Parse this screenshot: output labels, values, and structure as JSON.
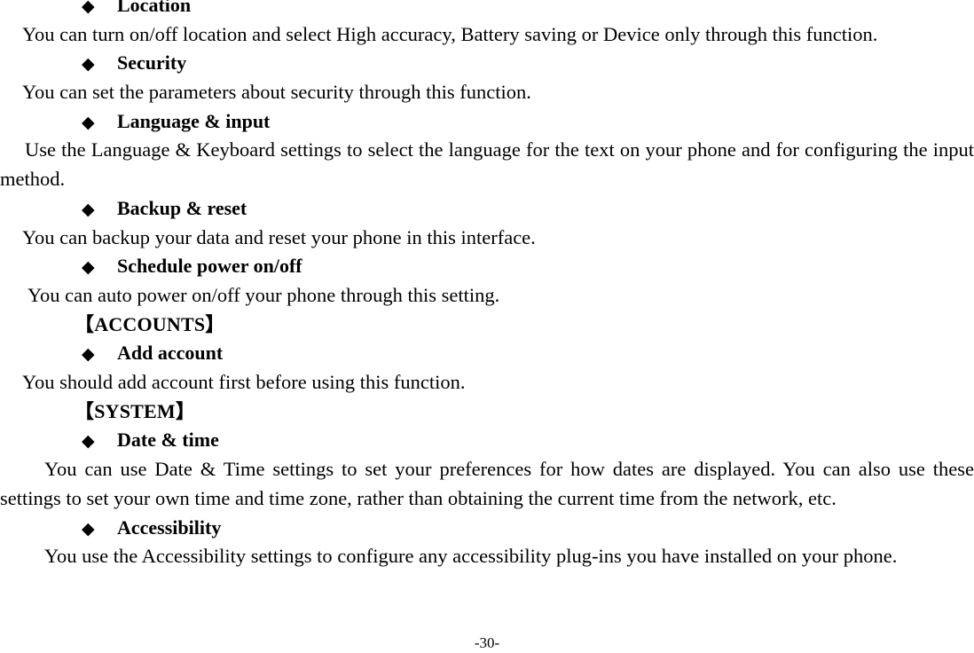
{
  "document": {
    "page_number_label": "-30-",
    "bullet_glyph": "◆",
    "bracket_open": "【",
    "bracket_close": "】",
    "text_color": "#000000",
    "background_color": "#FFFFFF"
  },
  "blocks": [
    {
      "type": "bullet_heading",
      "label": "Location"
    },
    {
      "type": "paragraph",
      "text": "You can turn on/off location and select High accuracy, Battery saving or Device only through this function."
    },
    {
      "type": "bullet_heading",
      "label": "Security"
    },
    {
      "type": "paragraph",
      "text": "You can set the parameters about security through this function."
    },
    {
      "type": "bullet_heading",
      "label": "Language & input"
    },
    {
      "type": "paragraph_justified",
      "text": "Use the Language & Keyboard settings to select the language for the text on your phone and for configuring the input method."
    },
    {
      "type": "bullet_heading",
      "label": "Backup & reset"
    },
    {
      "type": "paragraph",
      "text": "You can backup your data and reset your phone in this interface."
    },
    {
      "type": "bullet_heading",
      "label": "Schedule power on/off"
    },
    {
      "type": "paragraph",
      "text": "You can auto power on/off your phone through this setting."
    },
    {
      "type": "section_heading",
      "label": "ACCOUNTS"
    },
    {
      "type": "bullet_heading",
      "label": "Add account"
    },
    {
      "type": "paragraph",
      "text": "You should add account first before using this function."
    },
    {
      "type": "section_heading",
      "label": "SYSTEM"
    },
    {
      "type": "bullet_heading",
      "label": "Date & time"
    },
    {
      "type": "paragraph_justified",
      "text": "You can use Date & Time settings to set your preferences for how dates are displayed. You can also use these settings to set your own time and time zone, rather than obtaining the current time from the network, etc."
    },
    {
      "type": "bullet_heading",
      "label": "Accessibility"
    },
    {
      "type": "paragraph_justified",
      "text": "You use the Accessibility settings to configure any accessibility plug-ins you have installed on your phone."
    }
  ]
}
